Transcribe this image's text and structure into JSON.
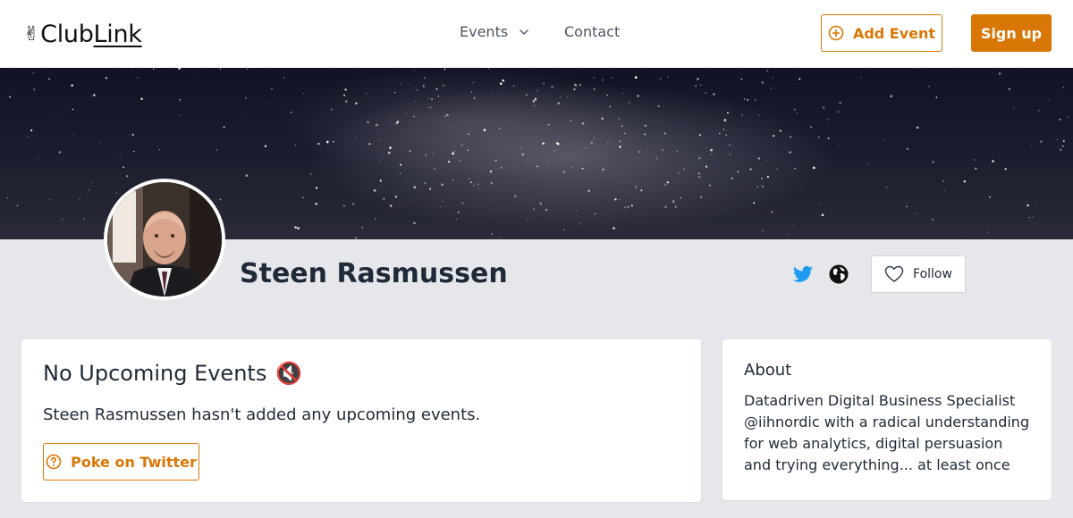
{
  "header": {
    "logo_emoji": "✌",
    "logo_text_a": "Club",
    "logo_text_b": "Link",
    "nav": [
      {
        "label": "Events"
      },
      {
        "label": "Contact"
      }
    ],
    "add_event_label": "Add Event",
    "signup_label": "Sign up",
    "accent_color": "#d97706"
  },
  "profile": {
    "name": "Steen Rasmussen",
    "follow_label": "Follow",
    "social_icons": [
      "twitter-icon",
      "globe-icon"
    ]
  },
  "events_card": {
    "title": "No Upcoming Events",
    "title_emoji": "🔇",
    "message": "Steen Rasmussen hasn't added any upcoming events.",
    "poke_label": "Poke on Twitter"
  },
  "about_card": {
    "title": "About",
    "text": "Datadriven Digital Business Specialist @iihnordic with a radical understanding for web analytics, digital persuasion and trying everything... at least once"
  }
}
